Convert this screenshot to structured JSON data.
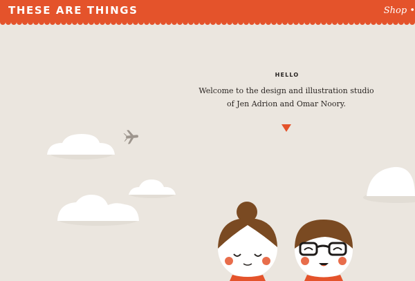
{
  "header": {
    "logo": "THESE ARE THINGS",
    "nav": {
      "shop_label": "Shop •"
    }
  },
  "intro": {
    "title": "HELLO",
    "line1": "Welcome to the design and illustration studio",
    "line2": "of Jen Adrion and Omar Noory."
  },
  "colors": {
    "accent": "#e4532b",
    "background": "#ebe6df",
    "hair": "#7a4a22",
    "skin": "#ffffff"
  },
  "icons": [
    "airplane-icon",
    "down-arrow-icon"
  ]
}
